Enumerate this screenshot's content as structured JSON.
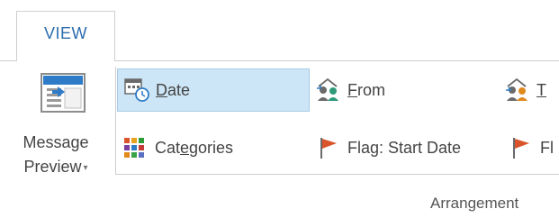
{
  "ribbon": {
    "active_tab": "VIEW",
    "message_preview": {
      "line1": "Message",
      "line2": "Preview",
      "dropdown_glyph": "▾"
    },
    "arrangement": {
      "group_label": "Arrangement",
      "items": [
        {
          "label_pre": "",
          "label_u": "D",
          "label_post": "ate",
          "icon": "calendar-clock-icon",
          "selected": true
        },
        {
          "label_pre": "",
          "label_u": "F",
          "label_post": "rom",
          "icon": "people-from-icon",
          "selected": false
        },
        {
          "label_pre": "",
          "label_u": "T",
          "label_post": "",
          "icon": "people-to-icon",
          "selected": false
        },
        {
          "label_pre": "Cat",
          "label_u": "e",
          "label_post": "gories",
          "icon": "categories-icon",
          "selected": false
        },
        {
          "label_pre": "Fla",
          "label_u": "g",
          "label_post": ": Start Date",
          "icon": "flag-icon",
          "selected": false
        },
        {
          "label_pre": "Fl",
          "label_u": "",
          "label_post": "",
          "icon": "flag-icon",
          "selected": false
        }
      ]
    },
    "colors": {
      "accent_blue": "#2b6cb0",
      "selection_bg": "#cde6f7",
      "flag_orange": "#d9542b"
    }
  }
}
